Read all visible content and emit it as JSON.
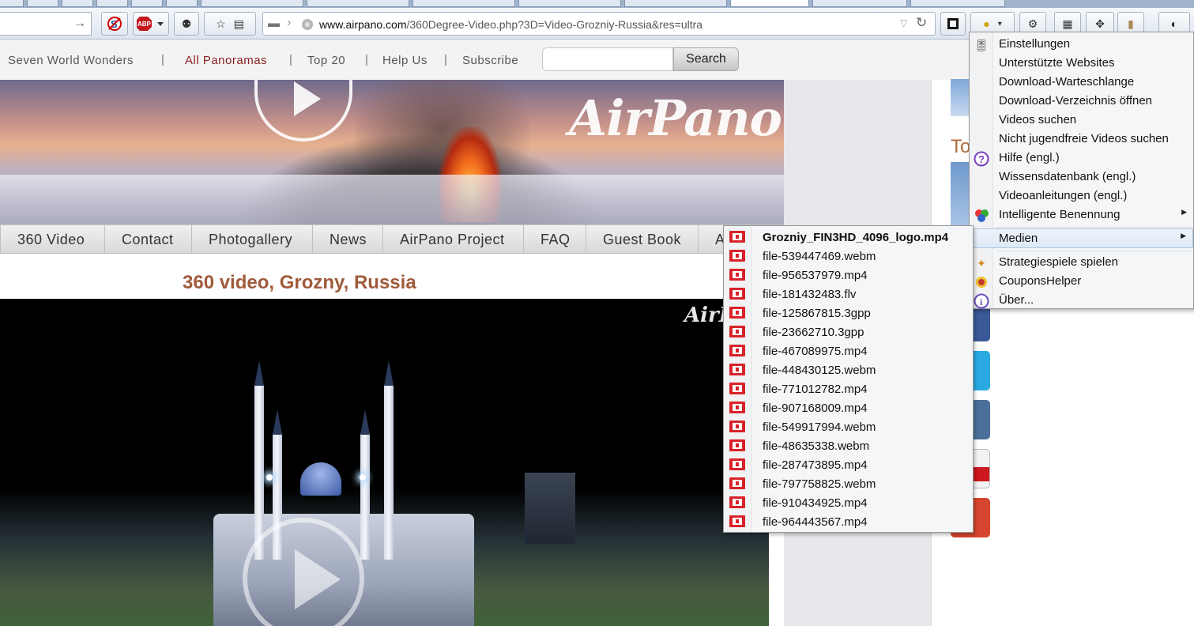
{
  "browser": {
    "url_host": "www.airpano.com",
    "url_rest": "/360Degree-Video.php?3D=Video-Grozniy-Russia&res=ultra",
    "abp_label": "ABP"
  },
  "site_nav": {
    "items": [
      "Seven World Wonders",
      "All Panoramas",
      "Top 20",
      "Help Us",
      "Subscribe"
    ],
    "search_button": "Search"
  },
  "banner": {
    "logo": "AirPano"
  },
  "site_menu": [
    "360 Video",
    "Contact",
    "Photogallery",
    "News",
    "AirPano Project",
    "FAQ",
    "Guest Book",
    "A"
  ],
  "page": {
    "video_title": "360 video, Grozny, Russia",
    "video_logo": "AirP",
    "sidebar_heading": "To"
  },
  "context_menu": {
    "items": [
      {
        "label": "Einstellungen",
        "icon": "settings-icon"
      },
      {
        "label": "Unterstützte Websites",
        "icon": ""
      },
      {
        "label": "Download-Warteschlange",
        "icon": ""
      },
      {
        "label": "Download-Verzeichnis öffnen",
        "icon": ""
      },
      {
        "label": "Videos suchen",
        "icon": ""
      },
      {
        "label": "Nicht jugendfreie Videos suchen",
        "icon": ""
      },
      {
        "label": "Hilfe (engl.)",
        "icon": "help-icon"
      },
      {
        "label": "Wissensdatenbank (engl.)",
        "icon": ""
      },
      {
        "label": "Videoanleitungen (engl.)",
        "icon": ""
      },
      {
        "label": "Intelligente Benennung",
        "icon": "smart-naming-icon"
      },
      {
        "label": "Medien",
        "icon": ""
      },
      {
        "label": "Strategiespiele spielen",
        "icon": "games-icon"
      },
      {
        "label": "CouponsHelper",
        "icon": "coupons-icon"
      },
      {
        "label": "Über...",
        "icon": "info-icon"
      }
    ]
  },
  "media_submenu": {
    "files": [
      "Grozniy_FIN3HD_4096_logo.mp4",
      "file-539447469.webm",
      "file-956537979.mp4",
      "file-181432483.flv",
      "file-125867815.3gpp",
      "file-23662710.3gpp",
      "file-467089975.mp4",
      "file-448430125.webm",
      "file-771012782.mp4",
      "file-907168009.mp4",
      "file-549917994.webm",
      "file-48635338.webm",
      "file-287473895.mp4",
      "file-797758825.webm",
      "file-910434925.mp4",
      "file-964443567.mp4"
    ]
  },
  "colors": {
    "menu_highlight": "#dfe9f5",
    "title_color": "#a05a3a",
    "film_icon": "#d8232a"
  }
}
